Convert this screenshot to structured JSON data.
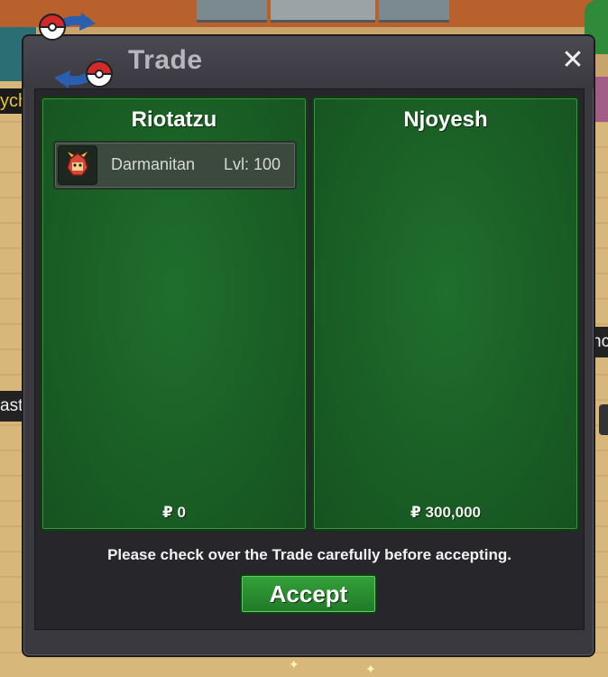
{
  "window": {
    "title": "Trade"
  },
  "left_panel": {
    "player_name": "Riotatzu",
    "items": [
      {
        "name": "Darmanitan",
        "level": "Lvl: 100"
      }
    ],
    "money": "₽ 0"
  },
  "right_panel": {
    "player_name": "Njoyesh",
    "money": "₽ 300,000"
  },
  "notice": "Please check over the Trade carefully before accepting.",
  "accept_label": "Accept",
  "background_labels": {
    "left1": "ych",
    "left2": "ast",
    "right1": "nc"
  },
  "colors": {
    "panel_green": "#1a5f25",
    "window_bg": "#3a3940",
    "accent_green": "#33a23a"
  }
}
